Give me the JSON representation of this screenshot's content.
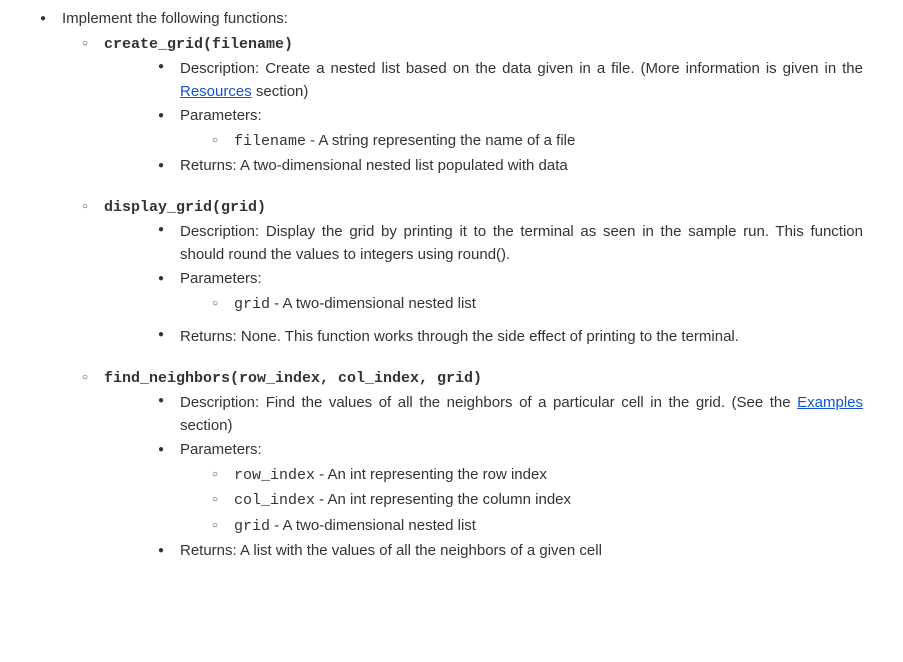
{
  "title": "Implement the following functions:",
  "functions": [
    {
      "signature": "create_grid(filename)",
      "desc_label": "Description:",
      "desc_before_link": "Create a nested list based on the data given in a file. (More information is given in the ",
      "desc_link": "Resources",
      "desc_after_link": " section)",
      "params_label": "Parameters:",
      "params": [
        {
          "name": "filename",
          "desc": " - A string representing the name of a file"
        }
      ],
      "returns_label": "Returns:",
      "returns": " A two-dimensional nested list populated with data"
    },
    {
      "signature": "display_grid(grid)",
      "desc_label": "Description:",
      "desc_text": " Display the grid by printing it to the terminal as seen in the sample run. This function should round the values to integers using round().",
      "params_label": "Parameters:",
      "params": [
        {
          "name": "grid",
          "desc": " - A two-dimensional nested list"
        }
      ],
      "returns_label": "Returns:",
      "returns": " None. This function works through the side effect of printing to the terminal."
    },
    {
      "signature": "find_neighbors(row_index, col_index, grid)",
      "desc_label": "Description:",
      "desc_before_link": "Find the values of all the neighbors of a particular cell in the grid. (See the ",
      "desc_link": "Examples",
      "desc_after_link": " section)",
      "params_label": "Parameters:",
      "params": [
        {
          "name": "row_index",
          "desc": " - An int representing the row index"
        },
        {
          "name": "col_index",
          "desc": " - An int representing the column index"
        },
        {
          "name": "grid",
          "desc": " - A two-dimensional nested list"
        }
      ],
      "returns_label": "Returns:",
      "returns": " A list with the values of all the neighbors of a given cell"
    }
  ]
}
